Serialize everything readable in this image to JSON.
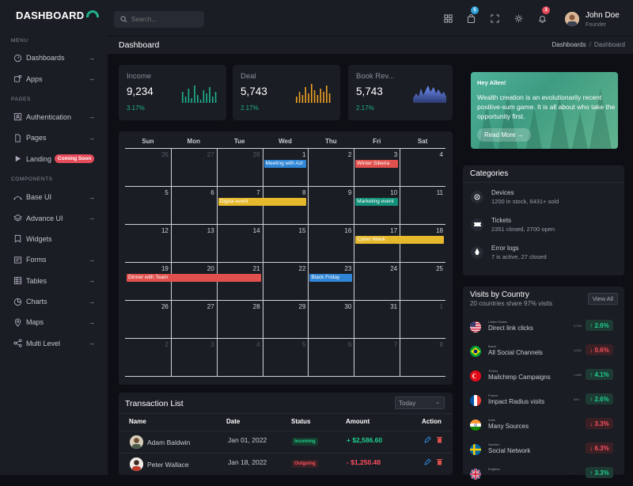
{
  "app": {
    "logo": "DASHBOARD"
  },
  "sidebar": {
    "sections": [
      "MENU",
      "PAGES",
      "COMPONENTS"
    ],
    "items": [
      {
        "label": "Dashboards",
        "icon": "gauge-icon",
        "arrow": "→"
      },
      {
        "label": "Apps",
        "icon": "apps-icon",
        "arrow": "→"
      },
      {
        "label": "Authentication",
        "icon": "user-card-icon",
        "arrow": "→"
      },
      {
        "label": "Pages",
        "icon": "file-icon",
        "arrow": "→"
      },
      {
        "label": "Landing",
        "icon": "play-icon",
        "badge": "Coming Soon"
      },
      {
        "label": "Base UI",
        "icon": "pen-tool-icon",
        "arrow": "→"
      },
      {
        "label": "Advance UI",
        "icon": "layers-icon",
        "arrow": "→"
      },
      {
        "label": "Widgets",
        "icon": "bookmark-icon",
        "arrow": ""
      },
      {
        "label": "Forms",
        "icon": "form-icon",
        "arrow": "→"
      },
      {
        "label": "Tables",
        "icon": "table-icon",
        "arrow": "→"
      },
      {
        "label": "Charts",
        "icon": "pie-chart-icon",
        "arrow": "→"
      },
      {
        "label": "Maps",
        "icon": "map-pin-icon",
        "arrow": "→"
      },
      {
        "label": "Multi Level",
        "icon": "share-icon",
        "arrow": "→"
      }
    ]
  },
  "topbar": {
    "search_placeholder": "Search...",
    "cart_badge": "5",
    "notif_badge": "3",
    "user_name": "John Doe",
    "user_role": "Founder"
  },
  "page": {
    "title": "Dashboard",
    "crumb_parent": "Dashboards",
    "crumb_sep": "/",
    "crumb_current": "Dashboard"
  },
  "stats": [
    {
      "name": "Income",
      "value": "9,234",
      "pct": "3.17%",
      "color": "#1fb18b"
    },
    {
      "name": "Deal",
      "value": "5,743",
      "pct": "2.17%",
      "color": "#f0a023"
    },
    {
      "name": "Book Rev...",
      "value": "5,743",
      "pct": "2.17%",
      "color": "#6e8ef7"
    }
  ],
  "promo": {
    "greeting": "Hey Allen!",
    "message": "Wealth creation is an evolutionarily recent positive-sum game. It is all about who take the opportunity first.",
    "button": "Read More →"
  },
  "calendar": {
    "days": [
      "Sun",
      "Mon",
      "Tue",
      "Wed",
      "Thu",
      "Fri",
      "Sat"
    ],
    "weeks": [
      [
        [
          "26",
          1
        ],
        [
          "27",
          1
        ],
        [
          "28",
          1
        ],
        [
          "1",
          0
        ],
        [
          "2",
          0
        ],
        [
          "3",
          0
        ],
        [
          "4",
          0
        ]
      ],
      [
        [
          "5",
          0
        ],
        [
          "6",
          0
        ],
        [
          "7",
          0
        ],
        [
          "8",
          0
        ],
        [
          "9",
          0
        ],
        [
          "10",
          0
        ],
        [
          "11",
          0
        ]
      ],
      [
        [
          "12",
          0
        ],
        [
          "13",
          0
        ],
        [
          "14",
          0
        ],
        [
          "15",
          0
        ],
        [
          "16",
          0
        ],
        [
          "17",
          0
        ],
        [
          "18",
          0
        ]
      ],
      [
        [
          "19",
          0
        ],
        [
          "20",
          0
        ],
        [
          "21",
          0
        ],
        [
          "22",
          0
        ],
        [
          "23",
          0
        ],
        [
          "24",
          0
        ],
        [
          "25",
          0
        ]
      ],
      [
        [
          "26",
          0
        ],
        [
          "27",
          0
        ],
        [
          "28",
          0
        ],
        [
          "29",
          0
        ],
        [
          "30",
          0
        ],
        [
          "31",
          0
        ],
        [
          "1",
          1
        ]
      ],
      [
        [
          "2",
          1
        ],
        [
          "3",
          1
        ],
        [
          "4",
          1
        ],
        [
          "5",
          1
        ],
        [
          "6",
          1
        ],
        [
          "7",
          1
        ],
        [
          "8",
          1
        ]
      ]
    ],
    "events": [
      {
        "title": "Meeting with Azr",
        "week": 0,
        "start": 3,
        "span": 1,
        "color": "#2f86d6"
      },
      {
        "title": "Winter Siberia",
        "week": 0,
        "start": 5,
        "span": 1,
        "color": "#e0504c"
      },
      {
        "title": "Digital event",
        "week": 1,
        "start": 2,
        "span": 2,
        "color": "#e6b82c"
      },
      {
        "title": "Marketing event",
        "week": 1,
        "start": 5,
        "span": 1,
        "color": "#14917a"
      },
      {
        "title": "Cyber Week",
        "week": 2,
        "start": 5,
        "span": 2,
        "color": "#e6b82c"
      },
      {
        "title": "Dinner with Team",
        "week": 3,
        "start": 0,
        "span": 3,
        "color": "#e0504c"
      },
      {
        "title": "Black Friday",
        "week": 3,
        "start": 4,
        "span": 1,
        "color": "#2f86d6"
      }
    ]
  },
  "categories": {
    "title": "Categories",
    "items": [
      {
        "name": "Devices",
        "detail": "1200 in stock, 6431+ sold",
        "icon": "disc-icon"
      },
      {
        "name": "Tickets",
        "detail": "2351 closed, 2700 open",
        "icon": "ticket-icon"
      },
      {
        "name": "Error logs",
        "detail": "7 is active, 27 closed",
        "icon": "bug-icon"
      }
    ]
  },
  "visits": {
    "title": "Visits by Country",
    "subtitle": "20 countries share 97% visits",
    "button": "View All",
    "rows": [
      {
        "country": "United States",
        "channel": "Direct link clicks",
        "num": "9,763",
        "pct": "↑ 2.6%",
        "dir": "up",
        "flag": "us"
      },
      {
        "country": "Brazil",
        "channel": "All Social Channels",
        "num": "4,062",
        "pct": "↓ 0.6%",
        "dir": "down",
        "flag": "br"
      },
      {
        "country": "Turkey",
        "channel": "Mailchimp Campaigns",
        "num": "1,680",
        "pct": "↑ 4.1%",
        "dir": "up",
        "flag": "tr"
      },
      {
        "country": "France",
        "channel": "Impact Radius visits",
        "num": "849",
        "pct": "↑ 2.6%",
        "dir": "up",
        "flag": "fr"
      },
      {
        "country": "India",
        "channel": "Many Sources",
        "num": "-",
        "pct": "↓ 3.3%",
        "dir": "down",
        "flag": "in"
      },
      {
        "country": "Sweden",
        "channel": "Social Network",
        "num": "-",
        "pct": "↓ 6.3%",
        "dir": "down",
        "flag": "se"
      },
      {
        "country": "England",
        "channel": "",
        "num": "-",
        "pct": "↑ 3.3%",
        "dir": "up",
        "flag": "en"
      }
    ]
  },
  "transactions": {
    "title": "Transaction List",
    "filter": "Today",
    "columns": [
      "Name",
      "Date",
      "Status",
      "Amount",
      "Action"
    ],
    "rows": [
      {
        "name": "Adam Baldwin",
        "date": "Jan 01, 2022",
        "status": "Incoming",
        "kind": "in",
        "amount": "+ $2,586.60"
      },
      {
        "name": "Peter Wallace",
        "date": "Jan 18, 2022",
        "status": "Outgoing",
        "kind": "out",
        "amount": "- $1,250.48"
      }
    ]
  },
  "colors": {
    "accent": "#1fb18b",
    "up": "#1fd18e",
    "down": "#ff4f5e",
    "sidebar": "#1a1d24",
    "bg": "#0d0f14"
  }
}
